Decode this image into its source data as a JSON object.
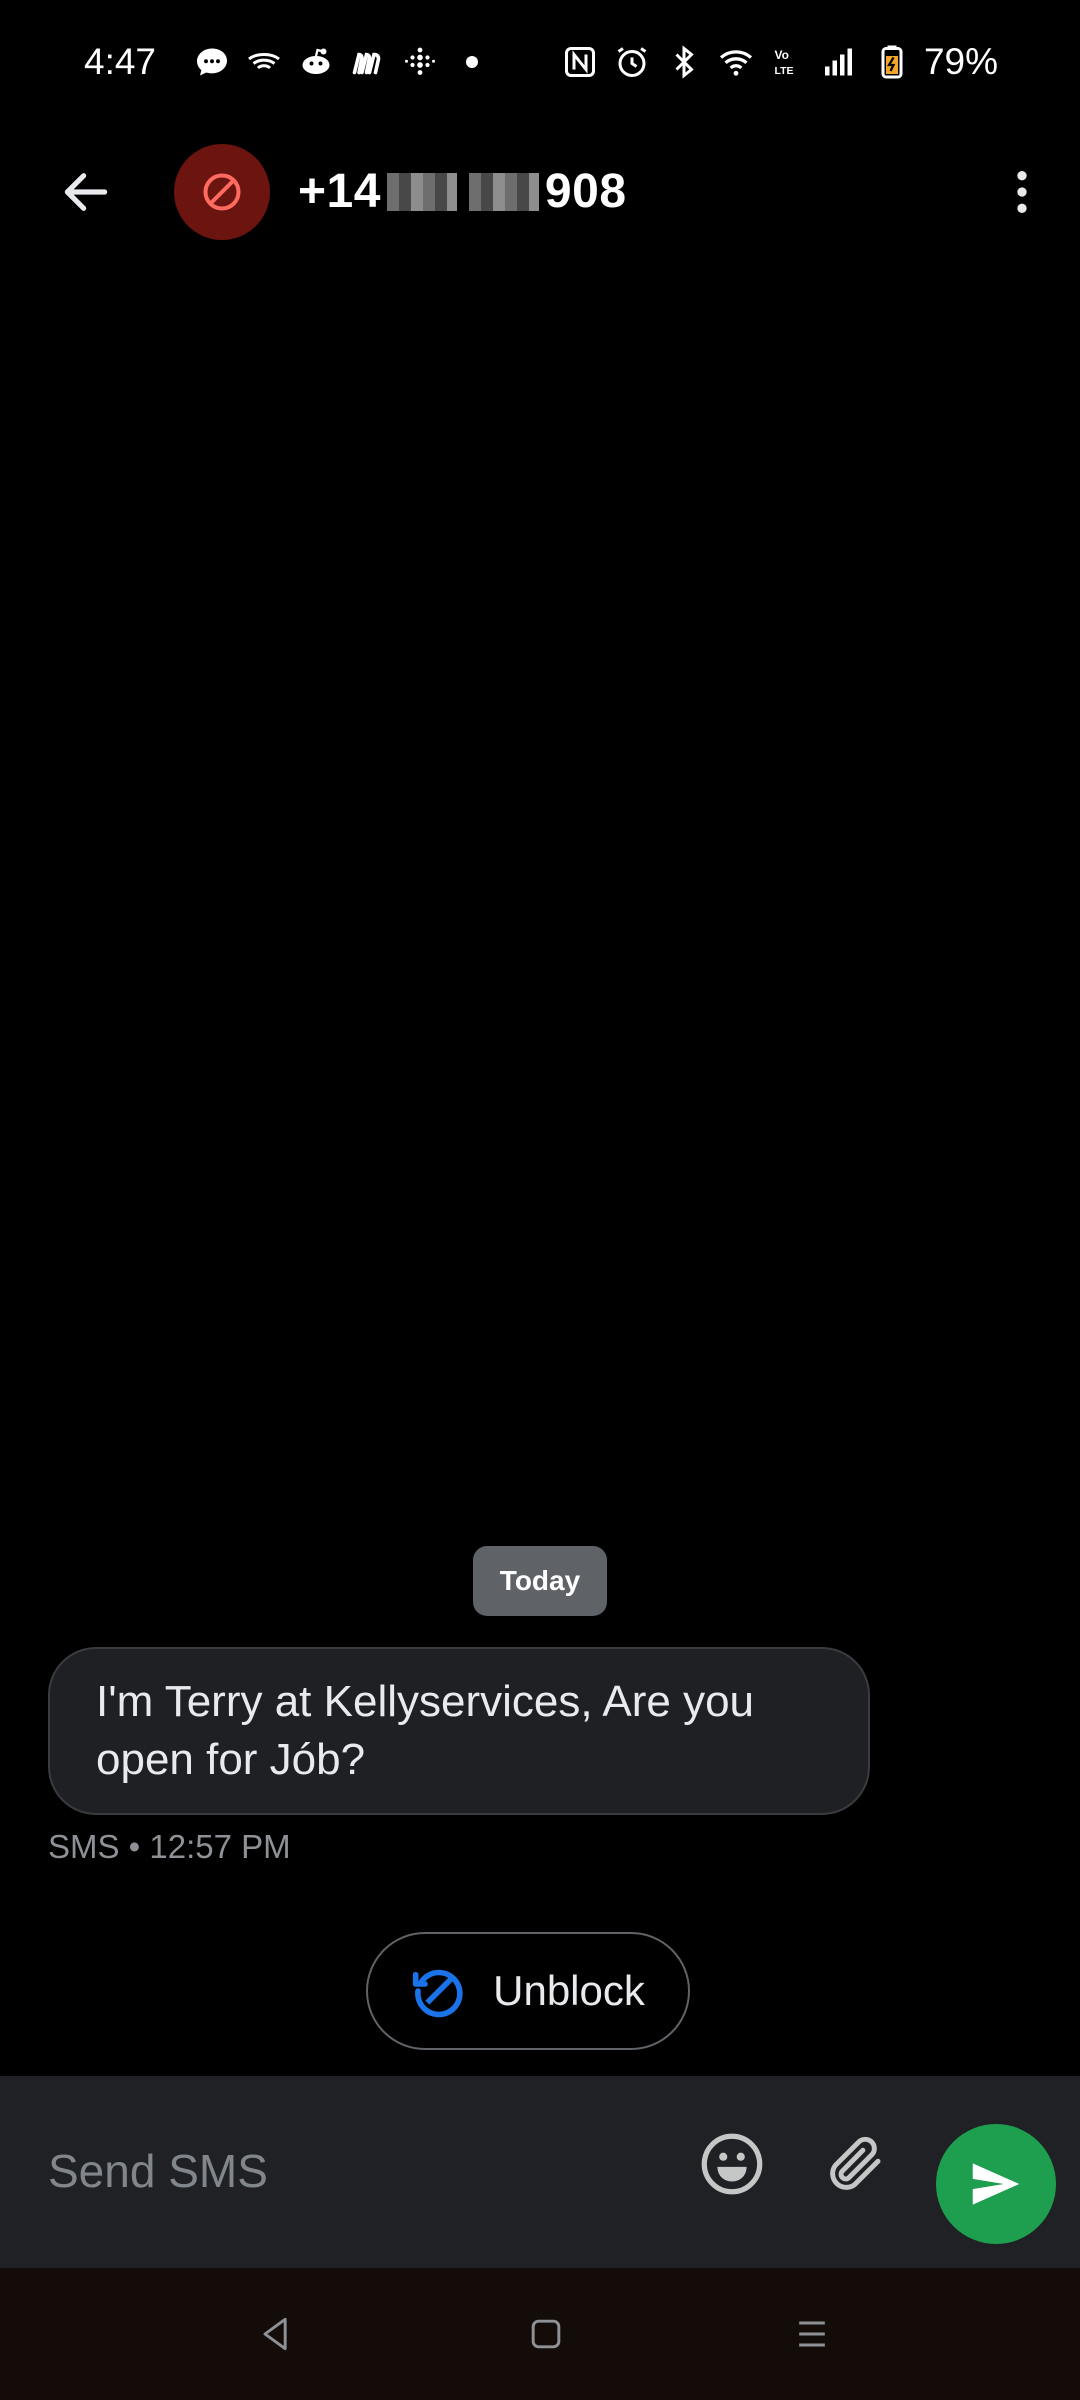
{
  "status_bar": {
    "time": "4:47",
    "battery": "79%",
    "icons_left": [
      "chat-bubble-icon",
      "wifi-calling-icon",
      "reddit-icon",
      "app-m-icon",
      "fitbit-icon"
    ],
    "icons_right": [
      "nfc-icon",
      "alarm-icon",
      "bluetooth-icon",
      "wifi-icon",
      "volte-icon",
      "signal-icon",
      "battery-icon"
    ]
  },
  "header": {
    "title_start": "+14",
    "title_end": "908",
    "avatar_icon": "blocked-icon",
    "avatar_color": "#6b1410"
  },
  "conversation": {
    "date_chip": "Today",
    "messages": [
      {
        "text": "I'm Terry at Kellyservices,  Are you open for Jób?",
        "meta": "SMS • 12:57 PM"
      }
    ]
  },
  "unblock": {
    "label": "Unblock",
    "icon": "unblock-icon",
    "accent": "#1a73e8"
  },
  "compose": {
    "placeholder": "Send SMS",
    "value": "",
    "send_color": "#1e9e4f"
  },
  "nav": {
    "buttons": [
      "back-nav-icon",
      "home-nav-icon",
      "recents-nav-icon"
    ]
  }
}
